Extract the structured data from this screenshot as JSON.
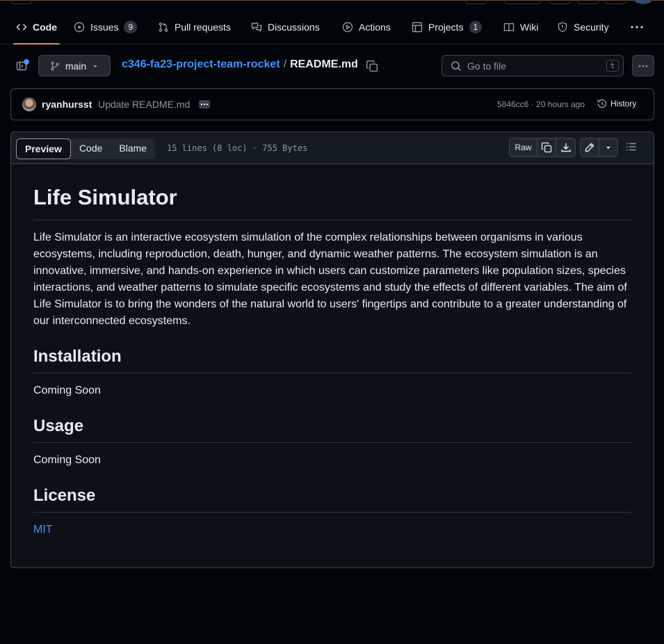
{
  "nav": {
    "items": [
      {
        "label": "Code",
        "icon": "code-icon",
        "active": true
      },
      {
        "label": "Issues",
        "icon": "issue-opened-icon",
        "count": "9"
      },
      {
        "label": "Pull requests",
        "icon": "git-pull-request-icon"
      },
      {
        "label": "Discussions",
        "icon": "comment-discussion-icon"
      },
      {
        "label": "Actions",
        "icon": "play-icon"
      },
      {
        "label": "Projects",
        "icon": "table-icon",
        "count": "1"
      },
      {
        "label": "Wiki",
        "icon": "book-icon"
      },
      {
        "label": "Security",
        "icon": "shield-icon"
      }
    ]
  },
  "file_bar": {
    "branch": "main",
    "repo": "c346-fa23-project-team-rocket",
    "separator": "/",
    "filename": "README.md",
    "search_placeholder": "Go to file",
    "search_shortcut": "t"
  },
  "commit": {
    "author": "ryanhursst",
    "message": "Update README.md",
    "meta": "5846cc6 · 20 hours ago",
    "history_label": "History"
  },
  "viewer": {
    "tabs": [
      "Preview",
      "Code",
      "Blame"
    ],
    "file_info": "15 lines (8 loc) · 755 Bytes",
    "raw_label": "Raw"
  },
  "readme": {
    "title": "Life Simulator",
    "intro": "Life Simulator is an interactive ecosystem simulation of the complex relationships between organisms in various ecosystems, including reproduction, death, hunger, and dynamic weather patterns. The ecosystem simulation is an innovative, immersive, and hands-on experience in which users can customize parameters like population sizes, species interactions, and weather patterns to simulate specific ecosystems and study the effects of different variables. The aim of Life Simulator is to bring the wonders of the natural world to users' fingertips and contribute to a greater understanding of our interconnected ecosystems.",
    "installation_heading": "Installation",
    "installation_text": "Coming Soon",
    "usage_heading": "Usage",
    "usage_text": "Coming Soon",
    "license_heading": "License",
    "license_link": "MIT"
  },
  "colors": {
    "background": "#010409",
    "accent_link": "#4493f8",
    "active_underline": "#f78166"
  }
}
